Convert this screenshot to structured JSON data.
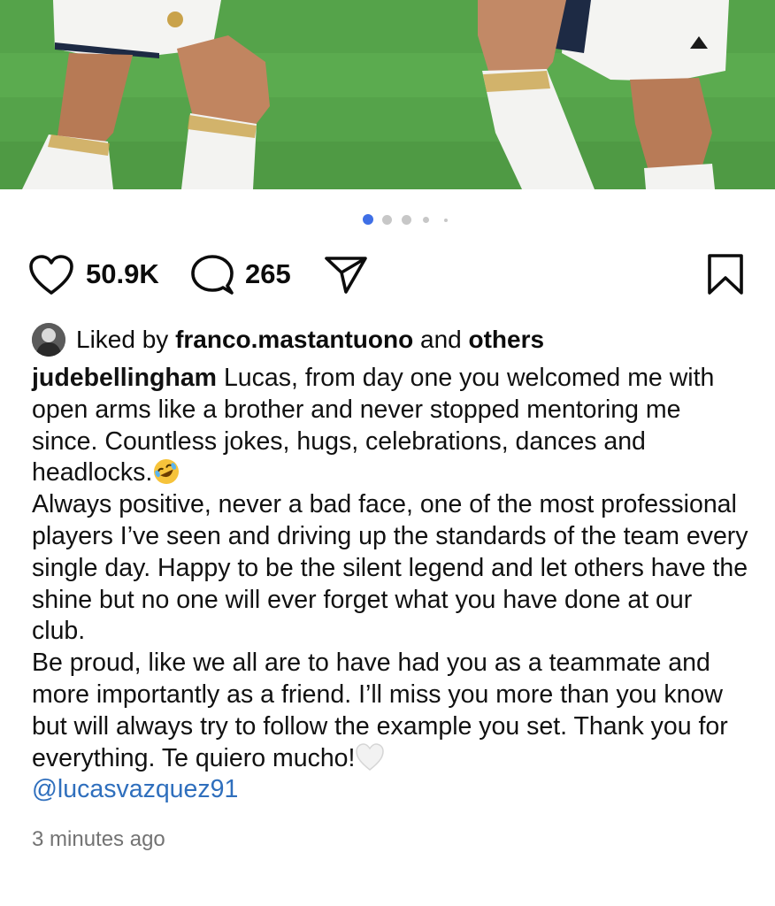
{
  "post": {
    "carousel": {
      "slide_count": 5,
      "active_index": 0,
      "accent": "#3f6fe6"
    },
    "actions": {
      "like_icon": "heart-icon",
      "like_count": "50.9K",
      "comment_icon": "comment-icon",
      "comment_count": "265",
      "share_icon": "send-icon",
      "save_icon": "bookmark-icon"
    },
    "liked_by": {
      "prefix": "Liked by",
      "user": "franco.mastantuono",
      "conjunction": "and",
      "others": "others"
    },
    "caption": {
      "username": "judebellingham",
      "para1": "Lucas, from day one you welcomed me with open arms like a brother and never stopped mentoring me since. Countless jokes, hugs, celebrations, dances and headlocks.",
      "para2": "Always positive, never a bad face, one of the most professional players I’ve seen and driving up the standards of the team every single day. Happy to be the silent legend and let others have the shine but no one will ever forget what you have done at our club.",
      "para3": "Be proud, like we all are to have had you as a teammate and more importantly as a friend. I’ll miss you more than you know but will always try to follow the example you set. Thank you for everything. Te quiero mucho!",
      "mention": "@lucasvazquez91"
    },
    "timestamp": "3 minutes ago",
    "colors": {
      "text": "#0c0c0c",
      "muted": "#737373",
      "link": "#2f6fbd"
    }
  }
}
